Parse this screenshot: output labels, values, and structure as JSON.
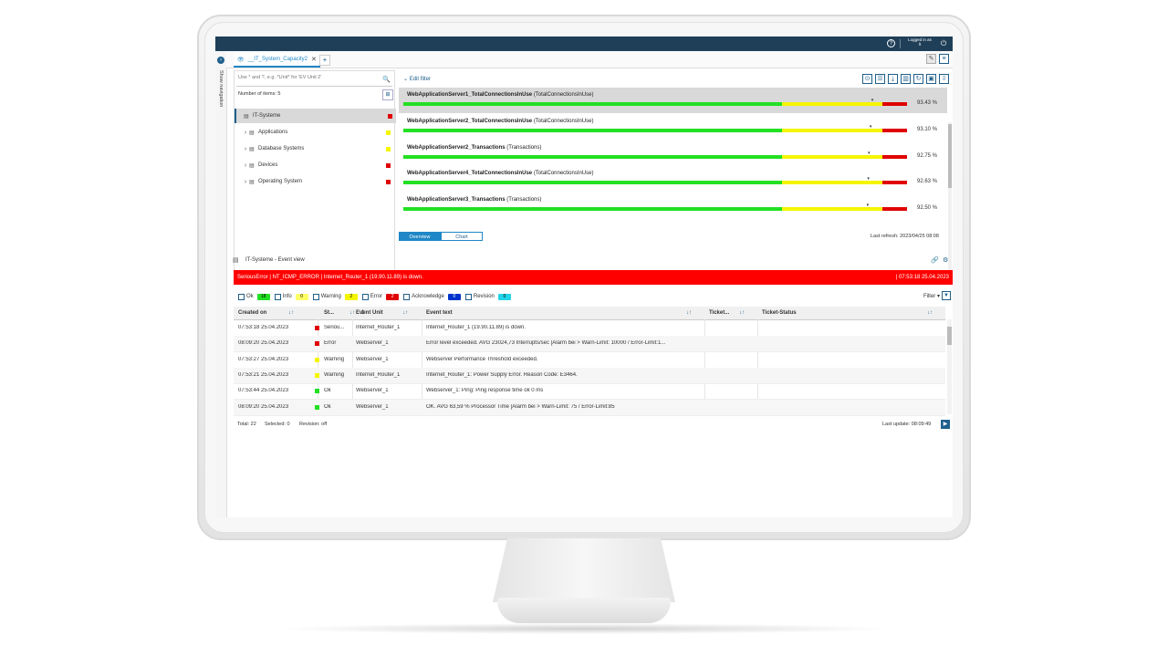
{
  "header": {
    "help": "?",
    "logged_in_label": "Logged in as",
    "user": "lt",
    "logout": "⏻"
  },
  "nav": {
    "label": "Show navigation",
    "btn": "›"
  },
  "tabs": {
    "active_label": "__IT_System_Capacity2",
    "close": "✕",
    "add": "+"
  },
  "tree": {
    "search_placeholder": "Use * and ?, e.g. *Unit* for 'EV Unit 2'",
    "items_label": "Number of items:",
    "items_count": "5",
    "items": [
      {
        "label": "IT-Systeme",
        "status_color": "#e00000",
        "has_children": false
      },
      {
        "label": "Applications",
        "status_color": "#f5f500",
        "has_children": true
      },
      {
        "label": "Database Systems",
        "status_color": "#f5f500",
        "has_children": true
      },
      {
        "label": "Devices",
        "status_color": "#e00000",
        "has_children": true
      },
      {
        "label": "Operating System",
        "status_color": "#e00000",
        "has_children": true
      }
    ]
  },
  "capacity": {
    "edit_filter": "Edit filter",
    "rows": [
      {
        "name": "WebApplicationServer1_TotalConnectionsInUse",
        "sub": "(TotalConnectionsInUse)",
        "pct": "93.43 %",
        "value": 93.43
      },
      {
        "name": "WebApplicationServer2_TotalConnectionsInUse",
        "sub": "(TotalConnectionsInUse)",
        "pct": "93.10 %",
        "value": 93.1
      },
      {
        "name": "WebApplicationServer2_Transactions",
        "sub": "(Transactions)",
        "pct": "92.75 %",
        "value": 92.75
      },
      {
        "name": "WebApplicationServer4_TotalConnectionsInUse",
        "sub": "(TotalConnectionsInUse)",
        "pct": "92.63 %",
        "value": 92.63
      },
      {
        "name": "WebApplicationServer3_Transactions",
        "sub": "(Transactions)",
        "pct": "92.50 %",
        "value": 92.5
      }
    ],
    "tab_overview": "Overview",
    "tab_chart": "Chart",
    "last_refresh": "Last refresh: 2023/04/25 08:08"
  },
  "event": {
    "title": "IT-Systeme - Event view",
    "alarm_text": "SeriousError | NT_ICMP_ERROR | Internet_Router_1 (19.90.11.89) is down.",
    "alarm_time": "| 07:53:18 25.04.2023",
    "filters": [
      {
        "label": "Ok",
        "count": "18",
        "bg": "#22e022",
        "fg": "#000"
      },
      {
        "label": "Info",
        "count": "0",
        "bg": "#ffff66",
        "fg": "#000"
      },
      {
        "label": "Warning",
        "count": "2",
        "bg": "#f5f500",
        "fg": "#000"
      },
      {
        "label": "Error",
        "count": "2",
        "bg": "#e00000",
        "fg": "#fff"
      },
      {
        "label": "Acknowledge",
        "count": "0",
        "bg": "#0033cc",
        "fg": "#fff"
      },
      {
        "label": "Revision",
        "count": "0",
        "bg": "#22d4e8",
        "fg": "#000"
      }
    ],
    "filter_label": "Filter",
    "columns": {
      "created": "Created on",
      "status": "St...",
      "status_sort": "1",
      "unit": "Event Unit",
      "text": "Event text",
      "ticket": "Ticket...",
      "ticket_status": "Ticket-Status"
    },
    "rows": [
      {
        "created": "07:53:18 25.04.2023",
        "status": "Seriou...",
        "color": "#e00000",
        "unit": "Internet_Router_1",
        "text": "Internet_Router_1 (19.90.11.89) is down."
      },
      {
        "created": "08:09:20 25.04.2023",
        "status": "Error",
        "color": "#e00000",
        "unit": "Webserver_1",
        "text": "Error level exceeded. AVG 23024,73 Interrupts/sec [Alarm bei > Warn-Limit: 10000 / Error-Limit:1..."
      },
      {
        "created": "07:53:27 25.04.2023",
        "status": "Warning",
        "color": "#f5f500",
        "unit": "Webserver_1",
        "text": "Webserver Performance Threshold exceeded."
      },
      {
        "created": "07:53:21 25.04.2023",
        "status": "Warning",
        "color": "#f5f500",
        "unit": "Internet_Router_1",
        "text": "Internet_Router_1: Power Supply Error. Reason Code: E3464."
      },
      {
        "created": "07:53:44 25.04.2023",
        "status": "Ok",
        "color": "#22e022",
        "unit": "Webserver_1",
        "text": "Webserver_1: Ping: Ping response time ok 0 ms"
      },
      {
        "created": "08:09:20 25.04.2023",
        "status": "Ok",
        "color": "#22e022",
        "unit": "Webserver_1",
        "text": "OK. AVG 63,59 % Processor Time [Alarm bei > Warn-Limit: 75 / Error-Limit:85"
      }
    ],
    "footer_total": "Total: 22",
    "footer_selected": "Selected: 0",
    "footer_revision": "Revision: off",
    "last_update": "Last update: 08:09:49"
  }
}
